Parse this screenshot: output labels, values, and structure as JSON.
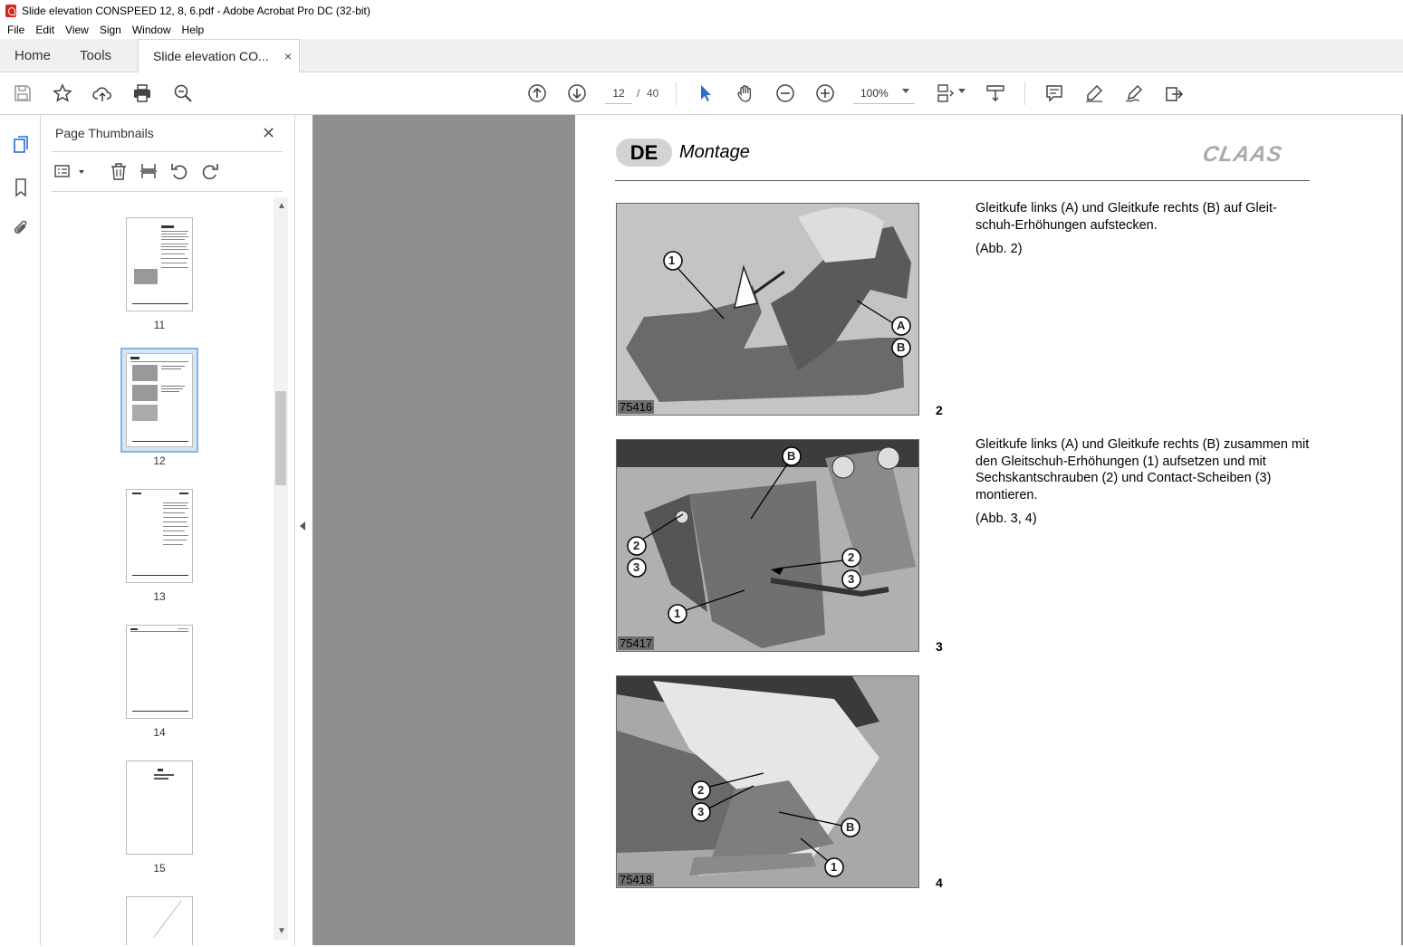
{
  "window": {
    "title": "Slide elevation CONSPEED 12, 8, 6.pdf - Adobe Acrobat Pro DC (32-bit)"
  },
  "menu": [
    "File",
    "Edit",
    "View",
    "Sign",
    "Window",
    "Help"
  ],
  "tabs": {
    "home": "Home",
    "tools": "Tools",
    "document": "Slide elevation CO...",
    "close": "×"
  },
  "toolbar": {
    "current_page": "12",
    "separator": "/",
    "total_pages": "40",
    "zoom": "100%"
  },
  "thumbnails_panel": {
    "title": "Page Thumbnails",
    "close": "✕",
    "pages": [
      "11",
      "12",
      "13",
      "14",
      "15"
    ],
    "selected_page": "12"
  },
  "document": {
    "lang": "DE",
    "section": "Montage",
    "brand": "CLAAS",
    "blocks": [
      {
        "figure_code": "75416",
        "figure_number": "2",
        "text": "Gleitkufe links (A) und Gleitkufe rechts (B) auf Gleit-schuh-Erhöhungen aufstecken.",
        "ref": "(Abb. 2)",
        "callouts": [
          "1",
          "A",
          "B"
        ]
      },
      {
        "figure_code": "75417",
        "figure_number": "3",
        "text": "Gleitkufe links (A) und Gleitkufe rechts (B) zusammen mit den Gleitschuh-Erhöhungen (1) aufsetzen und mit Sechskantschrauben (2) und Contact-Scheiben (3) montieren.",
        "ref": "(Abb. 3, 4)",
        "callouts": [
          "B",
          "2",
          "3",
          "2",
          "3",
          "1"
        ]
      },
      {
        "figure_code": "75418",
        "figure_number": "4",
        "callouts": [
          "2",
          "3",
          "B",
          "1"
        ]
      }
    ]
  },
  "colors": {
    "acrobat_red": "#d9261c",
    "viewer_bg": "#8f8f8f",
    "selection": "#d5e6f7",
    "badge": "#d3d3d3"
  }
}
